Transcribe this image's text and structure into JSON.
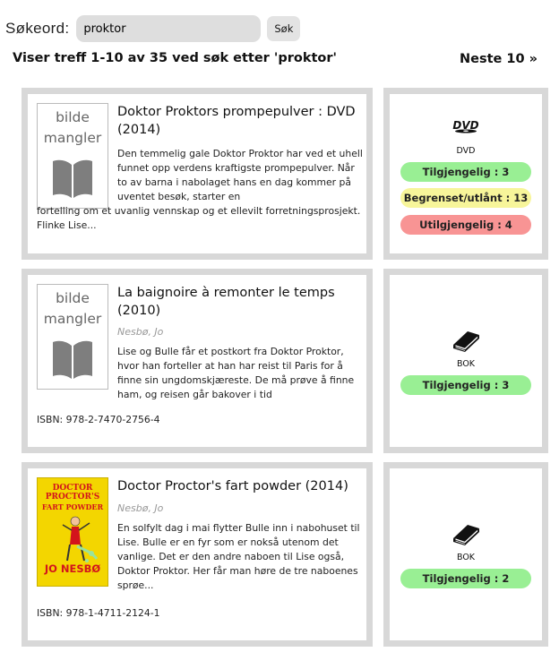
{
  "search": {
    "label": "Søkeord:",
    "value": "proktor",
    "button_label": "Søk"
  },
  "summary": "Viser treff 1-10 av 35 ved søk etter 'proktor'",
  "next_link": "Neste 10 »",
  "colors": {
    "available": "#99ef94",
    "limited": "#f7f59a",
    "unavailable": "#f89494",
    "card_border": "#d8d8d8"
  },
  "results": [
    {
      "title": "Doktor Proktors prompepulver : DVD (2014)",
      "cover_placeholder": [
        "bilde",
        "mangler"
      ],
      "description_indent": "Den temmelig gale Doktor Proktor har ved et uhell funnet opp verdens kraftigste prompepulver. Når to av barna i nabolaget hans en dag kommer på uventet besøk, starter en",
      "description_rest": "fortelling om et uvanlig vennskap og et ellevilt forretningsprosjekt. Flinke Lise...",
      "media_icon": "dvd-icon",
      "media_label": "DVD",
      "availability": [
        {
          "label": "Tilgjengelig : 3",
          "status": "available"
        },
        {
          "label": "Begrenset/utlånt : 13",
          "status": "limited"
        },
        {
          "label": "Utilgjengelig : 4",
          "status": "unavailable"
        }
      ]
    },
    {
      "title": "La baignoire à remonter le temps (2010)",
      "author": "Nesbø, Jo",
      "cover_placeholder": [
        "bilde",
        "mangler"
      ],
      "description": "Lise og Bulle får et postkort fra Doktor Proktor, hvor han forteller at han har reist til Paris for å finne sin ungdomskjæreste. De må prøve å finne ham, og reisen går bakover i tid",
      "isbn": "ISBN: 978-2-7470-2756-4",
      "media_icon": "book-icon",
      "media_label": "BOK",
      "availability": [
        {
          "label": "Tilgjengelig : 3",
          "status": "available"
        }
      ]
    },
    {
      "title": "Doctor Proctor's fart powder (2014)",
      "author": "Nesbø, Jo",
      "cover_text": {
        "line1": "DOCTOR",
        "line2": "PROCTOR'S",
        "line3": "FART POWDER",
        "author": "JO NESBØ"
      },
      "description": "En solfylt dag i mai flytter Bulle inn i nabohuset til Lise. Bulle er en fyr som er nokså utenom det vanlige. Det er den andre naboen til Lise også, Doktor Proktor. Her får man høre de tre naboenes sprøe...",
      "isbn": "ISBN: 978-1-4711-2124-1",
      "media_icon": "book-icon",
      "media_label": "BOK",
      "availability": [
        {
          "label": "Tilgjengelig : 2",
          "status": "available"
        }
      ]
    }
  ]
}
